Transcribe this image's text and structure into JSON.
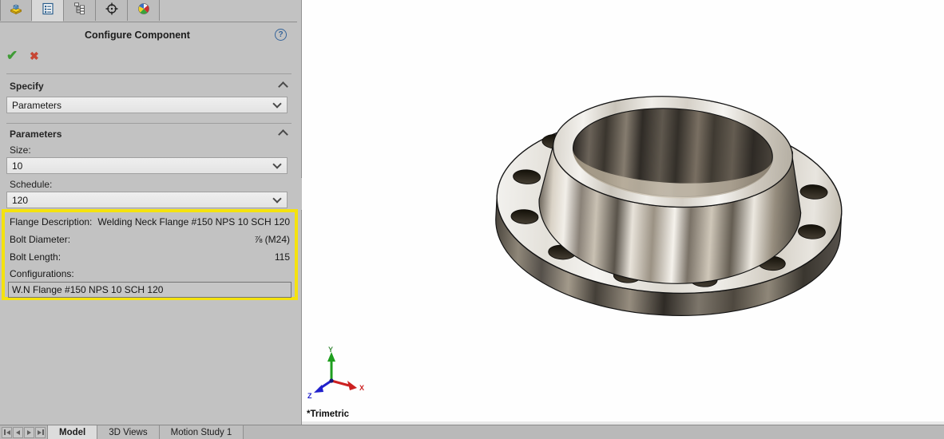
{
  "property_manager": {
    "title": "Configure Component",
    "help_icon": "?",
    "ok_icon": "✔",
    "cancel_icon": "✖",
    "manager_tabs": [
      {
        "icon": "part-icon",
        "active": false
      },
      {
        "icon": "property-manager-icon",
        "active": true
      },
      {
        "icon": "configuration-manager-icon",
        "active": false
      },
      {
        "icon": "dimxpert-icon",
        "active": false
      },
      {
        "icon": "display-manager-icon",
        "active": false
      }
    ],
    "specify": {
      "label": "Specify",
      "selected": "Parameters"
    },
    "parameters": {
      "label": "Parameters",
      "size_label": "Size:",
      "size_value": "10",
      "schedule_label": "Schedule:",
      "schedule_value": "120"
    },
    "flange_info": {
      "highlight_color": "#f4e20e",
      "rows": [
        {
          "label": "Flange Description:",
          "value": "Welding Neck Flange #150 NPS 10 SCH 120"
        },
        {
          "label": "Bolt Diameter:",
          "value": "⅞ (M24)"
        },
        {
          "label": "Bolt Length:",
          "value": "115"
        }
      ],
      "configurations_label": "Configurations:",
      "configurations": [
        "W.N Flange #150 NPS 10 SCH 120"
      ]
    }
  },
  "viewport": {
    "model_name": "welding-neck-flange",
    "view_orientation": "*Trimetric",
    "triad": {
      "x_label": "X",
      "y_label": "Y",
      "z_label": "Z",
      "x_color": "#cc2020",
      "y_color": "#1e9e1e",
      "z_color": "#2020cc"
    }
  },
  "bottom_bar": {
    "nav_icons": [
      "first-icon",
      "previous-icon",
      "next-icon",
      "last-icon"
    ],
    "tabs": [
      {
        "label": "Model",
        "active": true
      },
      {
        "label": "3D Views",
        "active": false
      },
      {
        "label": "Motion Study 1",
        "active": false
      }
    ]
  }
}
